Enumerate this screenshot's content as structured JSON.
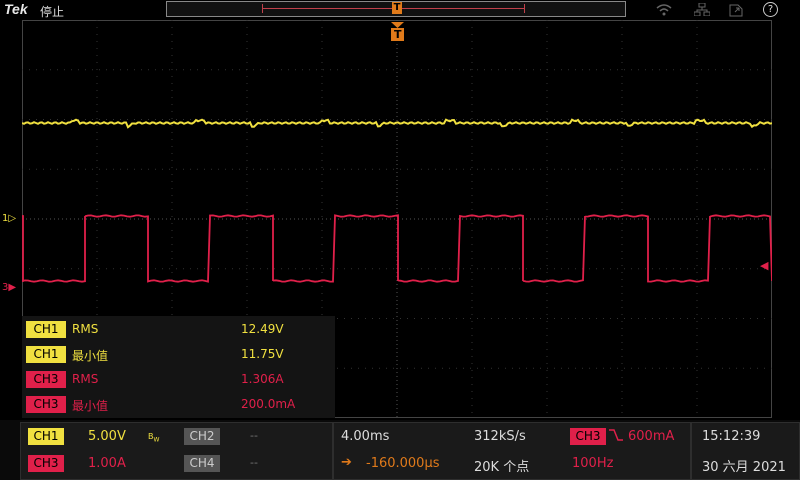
{
  "topbar": {
    "brand": "Tek",
    "run_state": "停止",
    "trigger_position_marker": "T",
    "help_symbol": "?",
    "icons": [
      "wifi-icon",
      "network-icon",
      "file-icon",
      "help-icon"
    ]
  },
  "waveform": {
    "trigger_marker": "T",
    "ch1_marker": "1",
    "ch3_marker": "3",
    "ch1_color": "#f0e040",
    "ch3_color": "#e0204a"
  },
  "measurements": [
    {
      "channel": "CH1",
      "name": "RMS",
      "value": "12.49V",
      "color": "#f0e040"
    },
    {
      "channel": "CH1",
      "name": "最小值",
      "value": "11.75V",
      "color": "#f0e040"
    },
    {
      "channel": "CH3",
      "name": "RMS",
      "value": "1.306A",
      "color": "#e0204a"
    },
    {
      "channel": "CH3",
      "name": "最小值",
      "value": "200.0mA",
      "color": "#e0204a"
    }
  ],
  "channels": {
    "ch1": {
      "label": "CH1",
      "scale": "5.00V",
      "bw": "B_W"
    },
    "ch2": {
      "label": "CH2",
      "scale": "--"
    },
    "ch3": {
      "label": "CH3",
      "scale": "1.00A"
    },
    "ch4": {
      "label": "CH4",
      "scale": "--"
    }
  },
  "horizontal": {
    "time_per_div": "4.00ms",
    "delay": "-160.000µs",
    "sample_rate": "312kS/s",
    "record_length": "20K 个点"
  },
  "trigger": {
    "source": "CH3",
    "level": "600mA",
    "frequency": "100Hz"
  },
  "clock": {
    "time": "15:12:39",
    "date": "30 六月 2021"
  }
}
